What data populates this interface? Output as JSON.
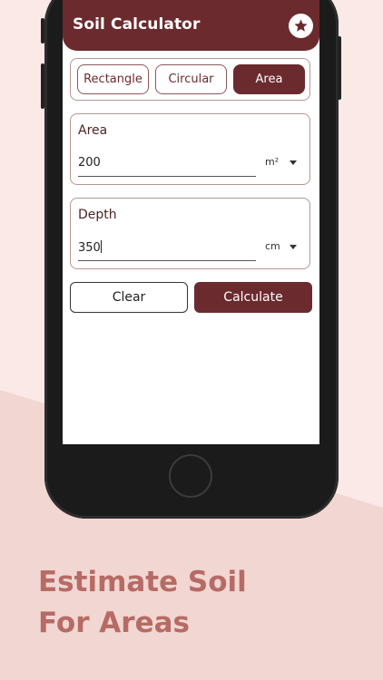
{
  "app": {
    "title": "Soil Calculator"
  },
  "tabs": [
    {
      "label": "Rectangle",
      "active": false
    },
    {
      "label": "Circular",
      "active": false
    },
    {
      "label": "Area",
      "active": true
    }
  ],
  "area_field": {
    "label": "Area",
    "value": "200",
    "unit": "m²"
  },
  "depth_field": {
    "label": "Depth",
    "value": "350",
    "unit": "cm"
  },
  "buttons": {
    "clear": "Clear",
    "calculate": "Calculate"
  },
  "headline": {
    "line1": "Estimate Soil",
    "line2": "For Areas"
  },
  "colors": {
    "primary": "#6b2b2e",
    "background": "#fbe9e7",
    "headline": "#b66b64"
  },
  "icons": {
    "favorite": "star-icon"
  }
}
